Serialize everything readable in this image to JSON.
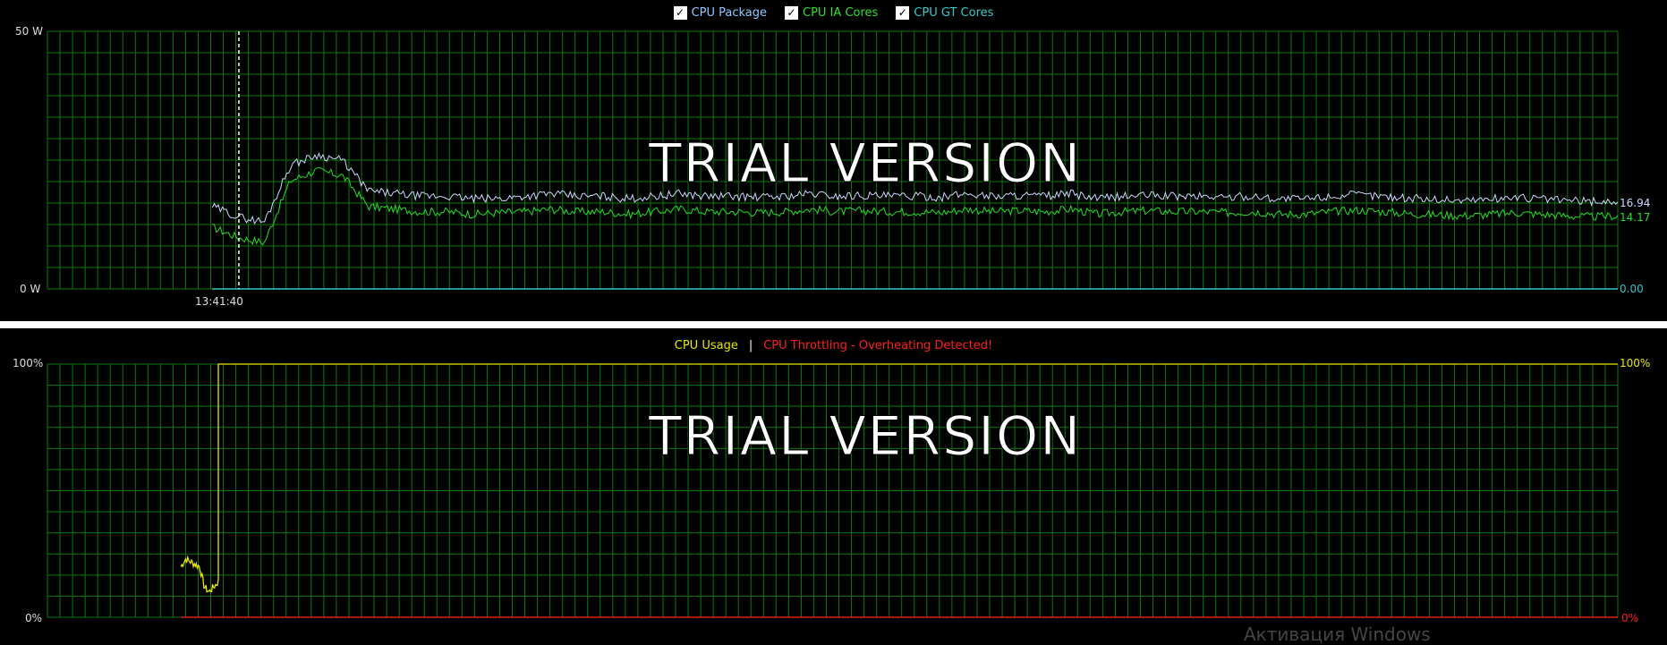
{
  "power_chart": {
    "legend": [
      {
        "label": "CPU Package",
        "color": "#8ec8ff",
        "checked": true
      },
      {
        "label": "CPU IA Cores",
        "color": "#2de02d",
        "checked": true
      },
      {
        "label": "CPU GT Cores",
        "color": "#35c8c8",
        "checked": true
      }
    ],
    "y_max_label": "50 W",
    "y_min_label": "0 W",
    "x_tick_label": "13:41:40",
    "watermark": "TRIAL VERSION",
    "readouts": {
      "package": "16.94",
      "ia_cores": "14.17",
      "gt_cores": "0.00"
    }
  },
  "usage_chart": {
    "legend_usage": "CPU Usage",
    "legend_separator": "|",
    "legend_throttle": "CPU Throttling - Overheating Detected!",
    "y_max_label": "100%",
    "y_min_label": "0%",
    "right_max_label": "100%",
    "right_min_label": "0%",
    "watermark": "TRIAL VERSION"
  },
  "os_watermark": "Активация Windows",
  "colors": {
    "grid": "#0b7a0b",
    "package": "#c8d8ff",
    "ia": "#22e022",
    "gt": "#30c8c8",
    "usage": "#e8e800",
    "throttle": "#e02020"
  },
  "chart_data": [
    {
      "type": "line",
      "title": "",
      "ylabel": "",
      "ylim": [
        0,
        50
      ],
      "series": [
        {
          "name": "CPU Package",
          "start_fraction": 0.105,
          "values": [
            16,
            14,
            13,
            24,
            26,
            25,
            19,
            18.5,
            18,
            18,
            17.5,
            17.5,
            18,
            18.5,
            18,
            18,
            17.5,
            18,
            18.5,
            18,
            18,
            17.8,
            18,
            18.5,
            18,
            18.2,
            18,
            18,
            17.8,
            18.5,
            18,
            18.2,
            18,
            18.5,
            17.5,
            18,
            18.2,
            18,
            18,
            17.8,
            18,
            17.5,
            17.5,
            18,
            18.3,
            18,
            17.6,
            17.4,
            17.2,
            17.4,
            17.8,
            17.5,
            17.2,
            17,
            16.94
          ],
          "final": 16.94
        },
        {
          "name": "CPU IA Cores",
          "start_fraction": 0.105,
          "values": [
            12,
            10,
            9,
            21,
            23,
            22,
            16,
            15.5,
            15,
            15,
            14.5,
            14.8,
            15,
            15.5,
            15,
            15,
            14.5,
            15,
            15.5,
            15,
            15,
            14.8,
            15,
            15.5,
            15,
            15.2,
            15,
            15,
            14.8,
            15.5,
            15,
            15.2,
            15,
            15.5,
            14.5,
            15,
            15.2,
            15,
            15,
            14.8,
            15,
            14.5,
            14.5,
            15,
            15.3,
            15,
            14.6,
            14.4,
            14.2,
            14.4,
            14.8,
            14.5,
            14.2,
            14,
            14.17
          ],
          "final": 14.17
        },
        {
          "name": "CPU GT Cores",
          "start_fraction": 0.105,
          "values": [
            0,
            0
          ],
          "final": 0.0
        }
      ]
    },
    {
      "type": "line",
      "title": "",
      "ylabel": "",
      "ylim": [
        0,
        100
      ],
      "series": [
        {
          "name": "CPU Usage",
          "start_fraction": 0.085,
          "values": [
            20,
            23,
            22,
            21,
            20,
            12,
            10,
            12,
            14,
            100,
            100,
            100
          ]
        },
        {
          "name": "CPU Throttling - Overheating Detected!",
          "start_fraction": 0.085,
          "values": [
            0,
            0
          ]
        }
      ]
    }
  ]
}
